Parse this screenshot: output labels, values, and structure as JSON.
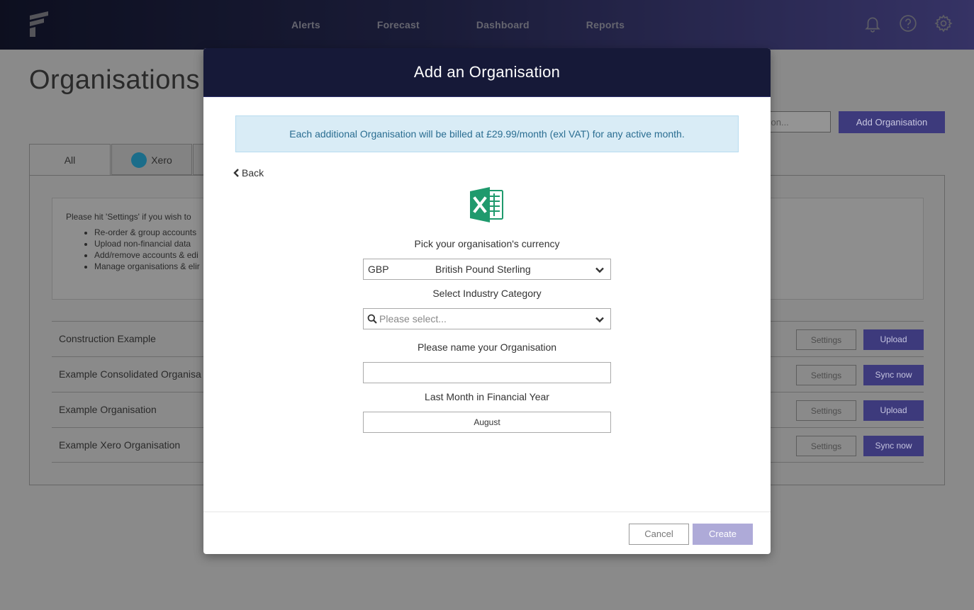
{
  "nav": {
    "items": [
      "Alerts",
      "Forecast",
      "Dashboard",
      "Reports"
    ],
    "icons": [
      "bell-icon",
      "help-icon",
      "gear-icon"
    ]
  },
  "page": {
    "title": "Organisations",
    "search_placeholder": "tion...",
    "add_button": "Add Organisation",
    "tabs": [
      "All",
      "Xero"
    ],
    "info": {
      "intro": "Please hit 'Settings' if you wish to",
      "items": [
        "Re-order & group accounts",
        "Upload non-financial data",
        "Add/remove accounts & edi",
        "Manage organisations & elir"
      ]
    },
    "orgs": [
      {
        "name": "Construction Example",
        "settings": "Settings",
        "action": "Upload"
      },
      {
        "name": "Example Consolidated Organisa",
        "settings": "Settings",
        "action": "Sync now"
      },
      {
        "name": "Example Organisation",
        "settings": "Settings",
        "action": "Upload"
      },
      {
        "name": "Example Xero Organisation",
        "settings": "Settings",
        "action": "Sync now"
      }
    ]
  },
  "modal": {
    "title": "Add an Organisation",
    "billing_notice": "Each additional Organisation will be billed at £29.99/month (exl VAT) for any active month.",
    "back_label": "Back",
    "currency_label": "Pick your organisation's currency",
    "currency_code": "GBP",
    "currency_name": "British Pound Sterling",
    "industry_label": "Select Industry Category",
    "industry_placeholder": "Please select...",
    "name_label": "Please name your Organisation",
    "name_value": "",
    "fy_label": "Last Month in Financial Year",
    "fy_value": "August",
    "cancel_label": "Cancel",
    "create_label": "Create"
  },
  "colors": {
    "primary": "#5b57b3",
    "modal_header": "#161938",
    "notice_bg": "#d9ecf6",
    "notice_text": "#2a6d91",
    "excel_green": "#1f9a6d"
  }
}
